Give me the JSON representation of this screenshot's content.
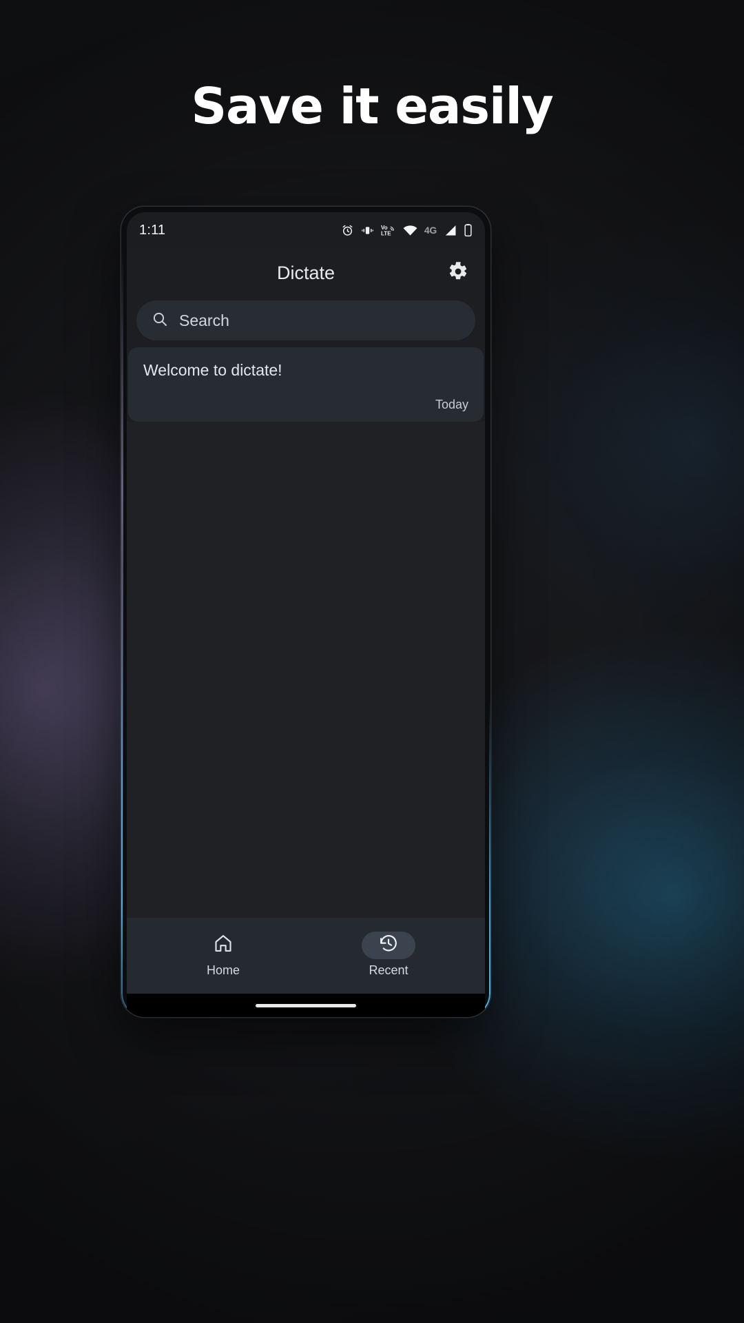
{
  "promo": {
    "headline": "Save it easily"
  },
  "phone": {
    "statusbar": {
      "time": "1:11",
      "icons": [
        {
          "name": "alarm-icon",
          "label": "alarm"
        },
        {
          "name": "vibrate-icon",
          "label": "vibrate"
        },
        {
          "name": "volte-icon",
          "label": "VoLTE"
        },
        {
          "name": "wifi-icon",
          "label": "wifi"
        },
        {
          "name": "network-type-label",
          "label": "4G"
        },
        {
          "name": "cellular-signal-icon",
          "label": "signal"
        },
        {
          "name": "battery-icon",
          "label": "battery"
        }
      ],
      "network_type": "4G",
      "volte_top": "Vo",
      "volte_bottom": "LTE"
    },
    "appbar": {
      "title": "Dictate",
      "settings_icon": "gear-icon"
    },
    "search": {
      "placeholder": "Search",
      "value": "",
      "icon": "search-icon"
    },
    "notes": [
      {
        "title": "Welcome to dictate!",
        "date": "Today"
      }
    ],
    "bottom_nav": {
      "items": [
        {
          "label": "Home",
          "icon": "home-icon",
          "selected": false
        },
        {
          "label": "Recent",
          "icon": "history-icon",
          "selected": true
        }
      ]
    }
  },
  "colors": {
    "accent_edge": "#50bef5",
    "screen_bg": "#1c1e21",
    "card_bg": "#272c32",
    "search_bg": "#282d33",
    "nav_bg": "#252a30",
    "nav_pill_active": "#3b444e",
    "text_primary": "#e9eaec",
    "text_secondary": "#c9ced4",
    "page_bg": "#161719"
  }
}
